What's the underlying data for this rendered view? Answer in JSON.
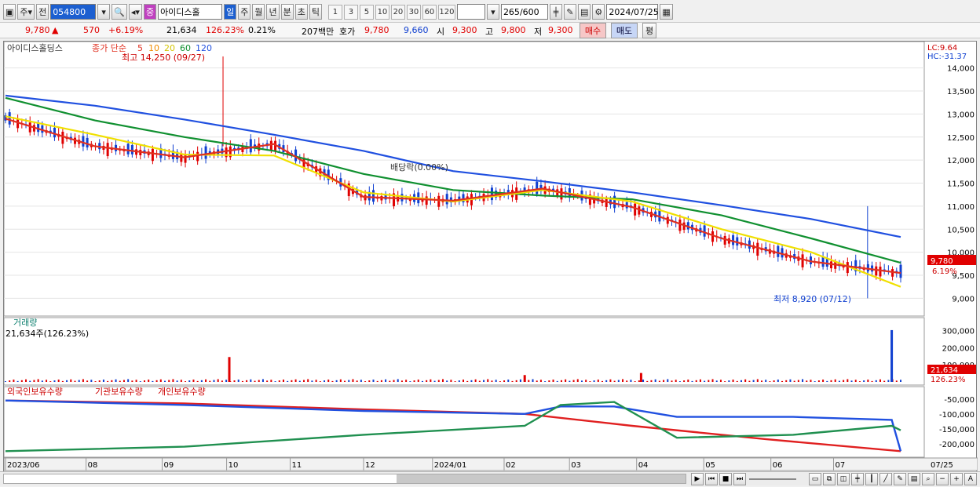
{
  "toolbar": {
    "market": "주",
    "prev": "전",
    "code": "054800",
    "badge": "중",
    "name": "아이디스홀",
    "periods": [
      "일",
      "주",
      "월",
      "년",
      "분",
      "초",
      "틱"
    ],
    "numbers": [
      "1",
      "3",
      "5",
      "10",
      "20",
      "30",
      "60",
      "120"
    ],
    "count": "265",
    "count_max": "/600",
    "date": "2024/07/25"
  },
  "quote": {
    "price": "9,780",
    "change": "570",
    "change_pct": "+6.19%",
    "volume": "21,634",
    "volume_ratio": "126.23%",
    "turnover": "0.21%",
    "amount": "207백만",
    "bid_label": "호가",
    "ask": "9,780",
    "bid": "9,660",
    "open_label": "시",
    "open": "9,300",
    "high_label": "고",
    "high": "9,800",
    "low_label": "저",
    "low": "9,300",
    "buy_btn": "매수",
    "sell_btn": "매도",
    "eval_btn": "평"
  },
  "colors": {
    "up": "#e00000",
    "down": "#1040d0",
    "ma5": "#e03020",
    "ma10": "#f08c00",
    "ma20": "#f0e000",
    "ma60": "#109030",
    "ma120": "#2050e0"
  },
  "chart_data": [
    {
      "type": "line",
      "title": "아이디스홀딩스",
      "subtitle": "종가 단순",
      "ma_labels": [
        "5",
        "10",
        "20",
        "60",
        "120"
      ],
      "lc_label": "LC:9.64",
      "hc_label": "HC:-31.37",
      "y_ticks": [
        "14,000",
        "13,500",
        "13,000",
        "12,500",
        "12,000",
        "11,500",
        "11,000",
        "10,500",
        "10,000",
        "9,500",
        "9,000"
      ],
      "ylim": [
        8700,
        14300
      ],
      "x_ticks": [
        "2023/06",
        "08",
        "09",
        "10",
        "11",
        "12",
        "2024/01",
        "02",
        "03",
        "04",
        "05",
        "06",
        "07",
        "07/25"
      ],
      "annotations": {
        "high": "최고 14,250 (09/27)",
        "low": "최저 8,920 (07/12)",
        "dividend": "배당락(0.00%)"
      },
      "last_price_label": "9,780",
      "last_pct_label": "6.19%",
      "series": [
        {
          "name": "120",
          "x": [
            0,
            10,
            20,
            30,
            40,
            50,
            60,
            70,
            80,
            90,
            100
          ],
          "values": [
            13400,
            13180,
            12880,
            12550,
            12200,
            11760,
            11540,
            11300,
            11020,
            10720,
            10330
          ]
        },
        {
          "name": "60",
          "x": [
            0,
            10,
            20,
            30,
            40,
            50,
            60,
            70,
            80,
            90,
            100
          ],
          "values": [
            13350,
            12860,
            12500,
            12200,
            11700,
            11350,
            11230,
            11150,
            10800,
            10300,
            9770
          ]
        },
        {
          "name": "20",
          "x": [
            0,
            10,
            20,
            30,
            40,
            50,
            60,
            70,
            80,
            90,
            100
          ],
          "values": [
            12950,
            12550,
            12120,
            12100,
            11300,
            11100,
            11350,
            11100,
            10500,
            10000,
            9250
          ]
        },
        {
          "name": "5",
          "x": [
            0,
            10,
            20,
            30,
            40,
            50,
            60,
            70,
            80,
            90,
            100
          ],
          "values": [
            12900,
            12300,
            12060,
            12350,
            11200,
            11120,
            11380,
            10980,
            10300,
            9800,
            9550
          ]
        }
      ]
    },
    {
      "type": "bar",
      "title": "거래량",
      "current_label": "21,634주(126.23%)",
      "y_ticks": [
        "300,000",
        "200,000",
        "100,000"
      ],
      "ylim": [
        0,
        320000
      ],
      "last_value_label": "21,634",
      "last_pct_label": "126.23%",
      "spikes": [
        {
          "x": 25,
          "value": 145000
        },
        {
          "x": 58,
          "value": 40000
        },
        {
          "x": 71,
          "value": 52000
        },
        {
          "x": 99,
          "value": 302000
        }
      ]
    },
    {
      "type": "line",
      "legend": [
        "외국인보유수량",
        "기관보유수량",
        "개인보유수량"
      ],
      "y_ticks": [
        "-50,000",
        "-100,000",
        "-150,000",
        "-200,000"
      ],
      "ylim": [
        -240000,
        -40000
      ],
      "series": [
        {
          "name": "외국인보유수량",
          "x": [
            0,
            20,
            40,
            58,
            70,
            85,
            100
          ],
          "values": [
            -55000,
            -65000,
            -85000,
            -100000,
            -140000,
            -185000,
            -225000
          ]
        },
        {
          "name": "기관보유수량",
          "x": [
            0,
            20,
            40,
            58,
            62,
            68,
            75,
            88,
            99,
            100
          ],
          "values": [
            -55000,
            -70000,
            -90000,
            -100000,
            -75000,
            -75000,
            -110000,
            -110000,
            -120000,
            -225000
          ]
        },
        {
          "name": "개인보유수량",
          "x": [
            0,
            20,
            40,
            58,
            62,
            68,
            75,
            88,
            99,
            103
          ],
          "values": [
            -225000,
            -210000,
            -170000,
            -140000,
            -70000,
            -60000,
            -180000,
            -170000,
            -140000,
            -155000
          ]
        }
      ]
    }
  ]
}
